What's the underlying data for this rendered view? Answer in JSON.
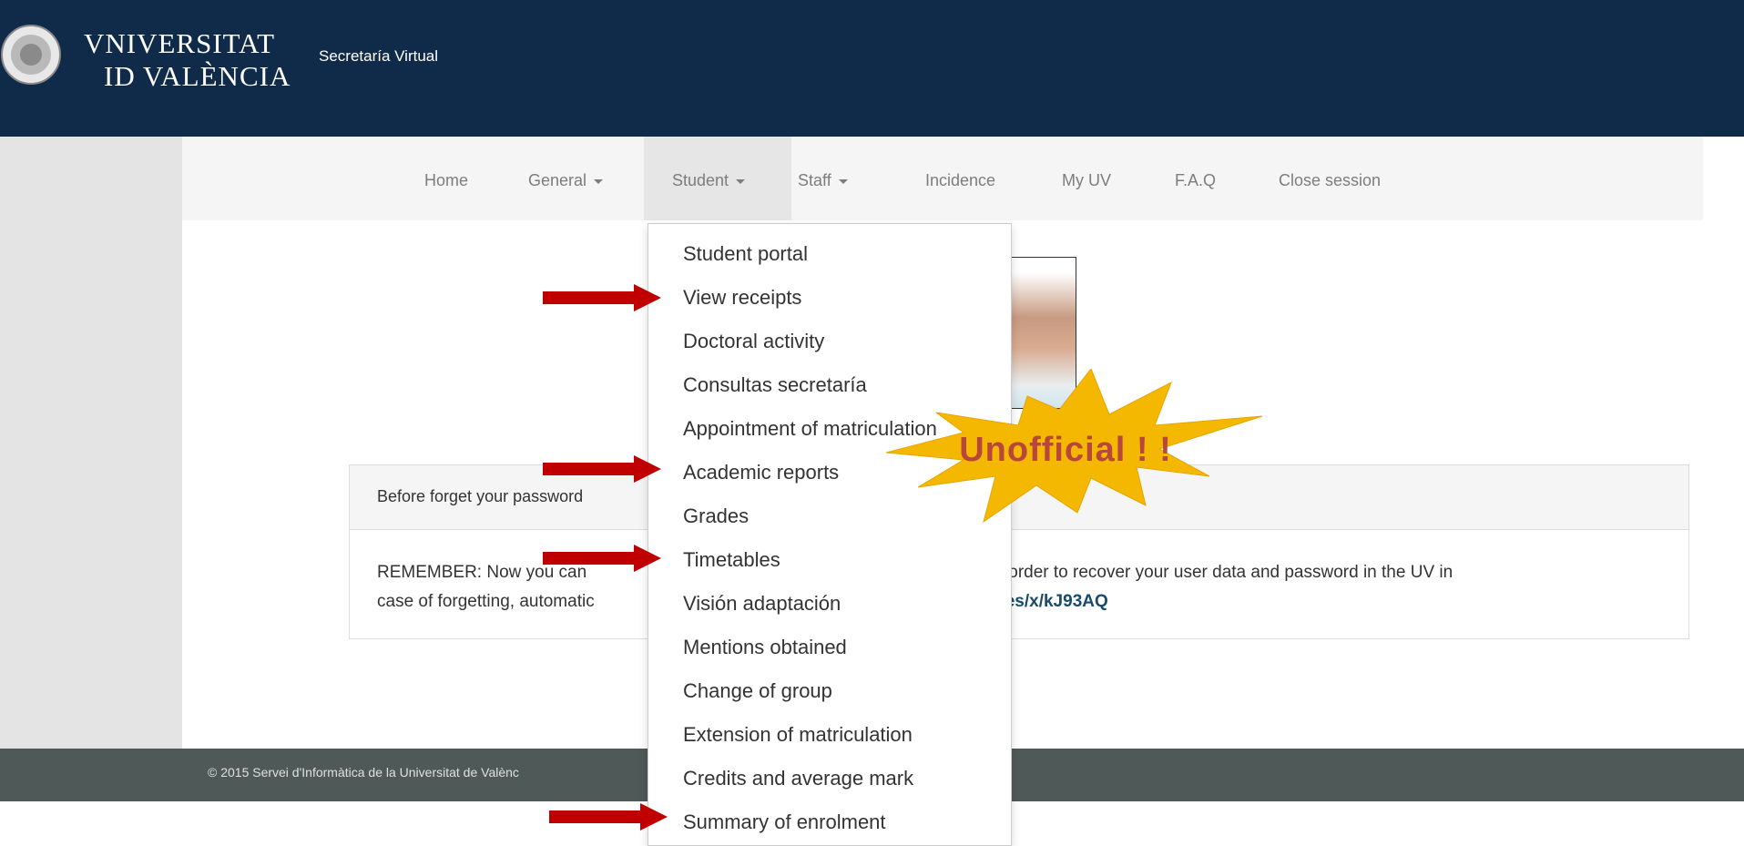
{
  "header": {
    "brand_line1": "VNIVERSITAT",
    "brand_line2": "ID VALÈNCIA",
    "app_title": "Secretaría Virtual"
  },
  "nav": {
    "items": [
      {
        "label": "Home"
      },
      {
        "label": "General"
      },
      {
        "label": "Student"
      },
      {
        "label": "Staff"
      },
      {
        "label": "Incidence"
      },
      {
        "label": "My UV"
      },
      {
        "label": "F.A.Q"
      },
      {
        "label": "Close session"
      }
    ]
  },
  "dropdown": {
    "items": [
      {
        "label": "Student portal"
      },
      {
        "label": "View receipts"
      },
      {
        "label": "Doctoral activity"
      },
      {
        "label": "Consultas secretaría"
      },
      {
        "label": "Appointment of matriculation"
      },
      {
        "label": "Academic reports"
      },
      {
        "label": "Grades"
      },
      {
        "label": "Timetables"
      },
      {
        "label": "Visión adaptación"
      },
      {
        "label": "Mentions obtained"
      },
      {
        "label": "Change of group"
      },
      {
        "label": "Extension of matriculation"
      },
      {
        "label": "Credits and average mark"
      },
      {
        "label": "Summary of enrolment"
      }
    ]
  },
  "panel": {
    "heading": "Before forget your password",
    "body_line1_start": "REMEMBER: Now you can",
    "body_line1_end": "tion, in order to recover your user data and password in the UV in",
    "body_line2_start": "case of forgetting, automatic",
    "body_link": "ela.uv.es/x/kJ93AQ"
  },
  "footer": {
    "copyright": "© 2015 Servei d'Informàtica de la Universitat de Valènc"
  },
  "annotation": {
    "stamp_text": "Unofficial ! !",
    "stamp_color": "#f5b800",
    "arrow_color": "#c00000"
  }
}
